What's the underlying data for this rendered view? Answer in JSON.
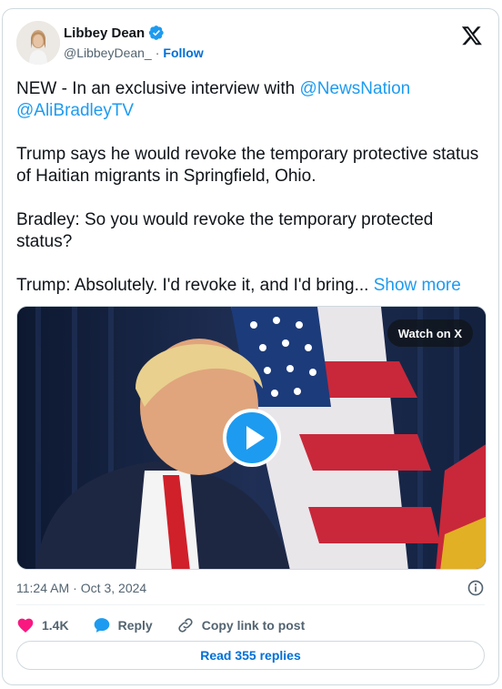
{
  "author": {
    "name": "Libbey Dean",
    "handle": "@LibbeyDean_",
    "separator": "·",
    "follow_label": "Follow"
  },
  "post": {
    "line1_prefix": "NEW - In an exclusive interview with ",
    "mention1": "@NewsNation",
    "mention2": "@AliBradleyTV",
    "paragraph2": "Trump says he would revoke the temporary protective status of Haitian migrants in Springfield, Ohio.",
    "paragraph3": "Bradley: So you would revoke the temporary protected status?",
    "paragraph4": "Trump: Absolutely. I'd revoke it, and I'd bring...",
    "show_more": "Show more"
  },
  "media": {
    "watch_label": "Watch on X"
  },
  "meta": {
    "time": "11:24 AM",
    "separator": "·",
    "date": "Oct 3, 2024"
  },
  "actions": {
    "likes": "1.4K",
    "reply": "Reply",
    "copy_link": "Copy link to post"
  },
  "footer": {
    "read_replies": "Read 355 replies"
  },
  "colors": {
    "accent": "#1d9bf0",
    "like": "#f91880",
    "link": "#006fd6"
  }
}
